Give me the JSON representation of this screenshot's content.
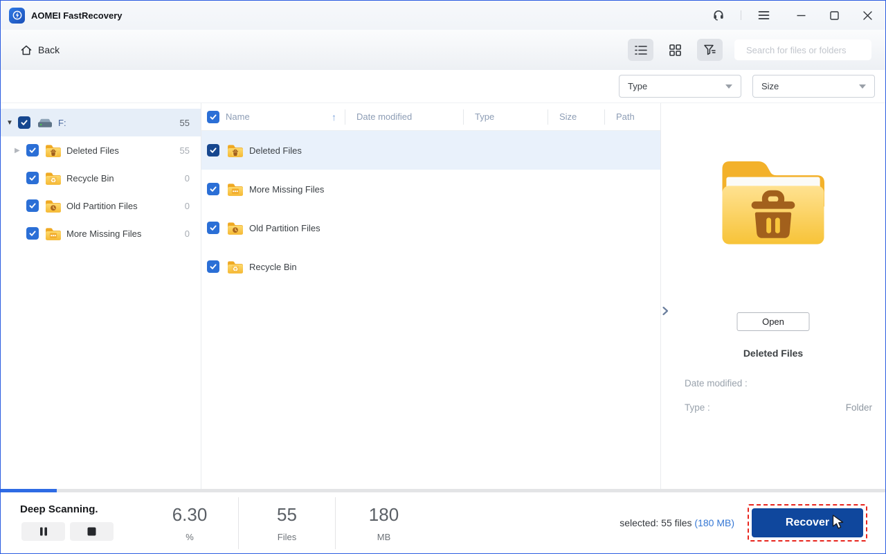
{
  "window": {
    "title": "AOMEI FastRecovery"
  },
  "titlebar": {
    "controls": [
      "support-headset",
      "menu",
      "minimize",
      "maximize",
      "close"
    ]
  },
  "toolbar": {
    "back_label": "Back",
    "search_placeholder": "Search for files or folders",
    "view_modes": [
      {
        "name": "list-view",
        "active": true
      },
      {
        "name": "grid-view",
        "active": false
      },
      {
        "name": "filter-view",
        "active": true
      }
    ]
  },
  "filters": {
    "type_label": "Type",
    "size_label": "Size"
  },
  "sidebar": {
    "items": [
      {
        "label": "F:",
        "count": "55",
        "icon": "drive",
        "level": 0,
        "expander": "expanded",
        "selected": true,
        "checkbox_dark": true
      },
      {
        "label": "Deleted Files",
        "count": "55",
        "icon": "folder-trash",
        "level": 1,
        "expander": "collapsed",
        "selected": false,
        "checkbox_dark": false
      },
      {
        "label": "Recycle Bin",
        "count": "0",
        "icon": "folder-recycle",
        "level": 1,
        "expander": "none",
        "selected": false,
        "checkbox_dark": false
      },
      {
        "label": "Old Partition Files",
        "count": "0",
        "icon": "folder-clock",
        "level": 1,
        "expander": "none",
        "selected": false,
        "checkbox_dark": false
      },
      {
        "label": "More Missing Files",
        "count": "0",
        "icon": "folder-dots",
        "level": 1,
        "expander": "none",
        "selected": false,
        "checkbox_dark": false
      }
    ]
  },
  "file_list": {
    "columns": [
      "Name",
      "Date modified",
      "Type",
      "Size",
      "Path"
    ],
    "sort": {
      "column": "Name",
      "direction": "ascending"
    },
    "rows": [
      {
        "name": "Deleted Files",
        "icon": "folder-trash",
        "selected": true,
        "checkbox_dark": true
      },
      {
        "name": "More Missing Files",
        "icon": "folder-dots",
        "selected": false,
        "checkbox_dark": false
      },
      {
        "name": "Old Partition Files",
        "icon": "folder-clock",
        "selected": false,
        "checkbox_dark": false
      },
      {
        "name": "Recycle Bin",
        "icon": "folder-recycle",
        "selected": false,
        "checkbox_dark": false
      }
    ]
  },
  "preview": {
    "open_label": "Open",
    "title": "Deleted Files",
    "date_modified_label": "Date modified :",
    "date_modified_value": "",
    "type_label": "Type :",
    "type_value": "Folder"
  },
  "statusbar": {
    "status": "Deep Scanning.",
    "progress_percent": 6.3,
    "stats": [
      {
        "value": "6.30",
        "unit": "%"
      },
      {
        "value": "55",
        "unit": "Files"
      },
      {
        "value": "180",
        "unit": "MB"
      }
    ],
    "selected_text": "selected: 55 files",
    "selected_size": "(180 MB)",
    "recover_label": "Recover"
  },
  "colors": {
    "accent_blue": "#2e6be4",
    "checkbox_blue": "#2b6fd6",
    "checkbox_dark": "#17478f",
    "recover_bg": "#0f479d",
    "annotation_red": "#e8251d",
    "link_blue": "#3577d4",
    "folder_gold": "#f6bb33",
    "selection_bg": "#e9f1fb"
  }
}
